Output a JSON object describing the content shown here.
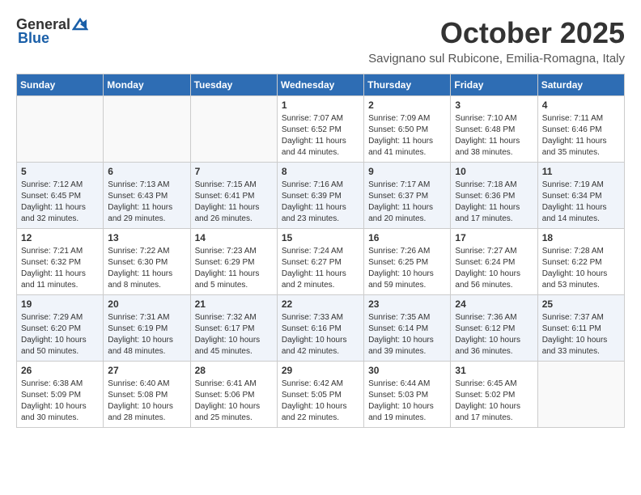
{
  "header": {
    "logo_general": "General",
    "logo_blue": "Blue",
    "month_title": "October 2025",
    "subtitle": "Savignano sul Rubicone, Emilia-Romagna, Italy"
  },
  "days_of_week": [
    "Sunday",
    "Monday",
    "Tuesday",
    "Wednesday",
    "Thursday",
    "Friday",
    "Saturday"
  ],
  "weeks": [
    [
      {
        "day": "",
        "info": ""
      },
      {
        "day": "",
        "info": ""
      },
      {
        "day": "",
        "info": ""
      },
      {
        "day": "1",
        "info": "Sunrise: 7:07 AM\nSunset: 6:52 PM\nDaylight: 11 hours\nand 44 minutes."
      },
      {
        "day": "2",
        "info": "Sunrise: 7:09 AM\nSunset: 6:50 PM\nDaylight: 11 hours\nand 41 minutes."
      },
      {
        "day": "3",
        "info": "Sunrise: 7:10 AM\nSunset: 6:48 PM\nDaylight: 11 hours\nand 38 minutes."
      },
      {
        "day": "4",
        "info": "Sunrise: 7:11 AM\nSunset: 6:46 PM\nDaylight: 11 hours\nand 35 minutes."
      }
    ],
    [
      {
        "day": "5",
        "info": "Sunrise: 7:12 AM\nSunset: 6:45 PM\nDaylight: 11 hours\nand 32 minutes."
      },
      {
        "day": "6",
        "info": "Sunrise: 7:13 AM\nSunset: 6:43 PM\nDaylight: 11 hours\nand 29 minutes."
      },
      {
        "day": "7",
        "info": "Sunrise: 7:15 AM\nSunset: 6:41 PM\nDaylight: 11 hours\nand 26 minutes."
      },
      {
        "day": "8",
        "info": "Sunrise: 7:16 AM\nSunset: 6:39 PM\nDaylight: 11 hours\nand 23 minutes."
      },
      {
        "day": "9",
        "info": "Sunrise: 7:17 AM\nSunset: 6:37 PM\nDaylight: 11 hours\nand 20 minutes."
      },
      {
        "day": "10",
        "info": "Sunrise: 7:18 AM\nSunset: 6:36 PM\nDaylight: 11 hours\nand 17 minutes."
      },
      {
        "day": "11",
        "info": "Sunrise: 7:19 AM\nSunset: 6:34 PM\nDaylight: 11 hours\nand 14 minutes."
      }
    ],
    [
      {
        "day": "12",
        "info": "Sunrise: 7:21 AM\nSunset: 6:32 PM\nDaylight: 11 hours\nand 11 minutes."
      },
      {
        "day": "13",
        "info": "Sunrise: 7:22 AM\nSunset: 6:30 PM\nDaylight: 11 hours\nand 8 minutes."
      },
      {
        "day": "14",
        "info": "Sunrise: 7:23 AM\nSunset: 6:29 PM\nDaylight: 11 hours\nand 5 minutes."
      },
      {
        "day": "15",
        "info": "Sunrise: 7:24 AM\nSunset: 6:27 PM\nDaylight: 11 hours\nand 2 minutes."
      },
      {
        "day": "16",
        "info": "Sunrise: 7:26 AM\nSunset: 6:25 PM\nDaylight: 10 hours\nand 59 minutes."
      },
      {
        "day": "17",
        "info": "Sunrise: 7:27 AM\nSunset: 6:24 PM\nDaylight: 10 hours\nand 56 minutes."
      },
      {
        "day": "18",
        "info": "Sunrise: 7:28 AM\nSunset: 6:22 PM\nDaylight: 10 hours\nand 53 minutes."
      }
    ],
    [
      {
        "day": "19",
        "info": "Sunrise: 7:29 AM\nSunset: 6:20 PM\nDaylight: 10 hours\nand 50 minutes."
      },
      {
        "day": "20",
        "info": "Sunrise: 7:31 AM\nSunset: 6:19 PM\nDaylight: 10 hours\nand 48 minutes."
      },
      {
        "day": "21",
        "info": "Sunrise: 7:32 AM\nSunset: 6:17 PM\nDaylight: 10 hours\nand 45 minutes."
      },
      {
        "day": "22",
        "info": "Sunrise: 7:33 AM\nSunset: 6:16 PM\nDaylight: 10 hours\nand 42 minutes."
      },
      {
        "day": "23",
        "info": "Sunrise: 7:35 AM\nSunset: 6:14 PM\nDaylight: 10 hours\nand 39 minutes."
      },
      {
        "day": "24",
        "info": "Sunrise: 7:36 AM\nSunset: 6:12 PM\nDaylight: 10 hours\nand 36 minutes."
      },
      {
        "day": "25",
        "info": "Sunrise: 7:37 AM\nSunset: 6:11 PM\nDaylight: 10 hours\nand 33 minutes."
      }
    ],
    [
      {
        "day": "26",
        "info": "Sunrise: 6:38 AM\nSunset: 5:09 PM\nDaylight: 10 hours\nand 30 minutes."
      },
      {
        "day": "27",
        "info": "Sunrise: 6:40 AM\nSunset: 5:08 PM\nDaylight: 10 hours\nand 28 minutes."
      },
      {
        "day": "28",
        "info": "Sunrise: 6:41 AM\nSunset: 5:06 PM\nDaylight: 10 hours\nand 25 minutes."
      },
      {
        "day": "29",
        "info": "Sunrise: 6:42 AM\nSunset: 5:05 PM\nDaylight: 10 hours\nand 22 minutes."
      },
      {
        "day": "30",
        "info": "Sunrise: 6:44 AM\nSunset: 5:03 PM\nDaylight: 10 hours\nand 19 minutes."
      },
      {
        "day": "31",
        "info": "Sunrise: 6:45 AM\nSunset: 5:02 PM\nDaylight: 10 hours\nand 17 minutes."
      },
      {
        "day": "",
        "info": ""
      }
    ]
  ]
}
